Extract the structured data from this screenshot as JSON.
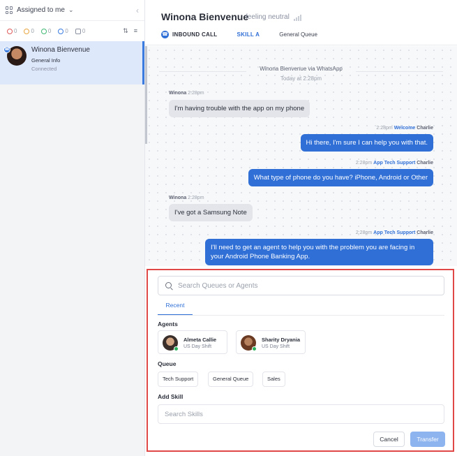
{
  "sidebar": {
    "filter_label": "Assigned to me",
    "counters": [
      {
        "icon": "alert-icon",
        "value": "0",
        "color": "#e05a5a"
      },
      {
        "icon": "clock-icon",
        "value": "0",
        "color": "#e8a640"
      },
      {
        "icon": "transfer-icon",
        "value": "0",
        "color": "#40b874"
      },
      {
        "icon": "phone-icon",
        "value": "0",
        "color": "#3a7be0"
      },
      {
        "icon": "message-icon",
        "value": "0",
        "color": "#8a90a0"
      }
    ],
    "contact": {
      "name": "Winona Bienvenue",
      "subtitle": "General Info",
      "status": "Connected"
    }
  },
  "header": {
    "name": "Winona Bienvenue",
    "sentiment": "feeling neutral",
    "call_type": "INBOUND CALL",
    "skill": "SKILL A",
    "queue": "General Queue"
  },
  "chat": {
    "source_line": "Winona Bienvenue via WhatsApp",
    "date_line": "Today at 2:28pm",
    "messages": [
      {
        "direction": "in",
        "sender": "Winona",
        "time": "2:28pm",
        "skill": "",
        "agent": "",
        "text": "I'm having trouble with the app on my phone"
      },
      {
        "direction": "out",
        "sender": "",
        "time": "2:28pm",
        "skill": "Welcome",
        "agent": "Charlie",
        "text": "Hi there, I'm sure I can help you with that."
      },
      {
        "direction": "out",
        "sender": "",
        "time": "2:28pm",
        "skill": "App Tech Support",
        "agent": "Charlie",
        "text": "What type of phone do you have? iPhone, Android or Other"
      },
      {
        "direction": "in",
        "sender": "Winona",
        "time": "2:28pm",
        "skill": "",
        "agent": "",
        "text": "I've got a Samsung Note"
      },
      {
        "direction": "out",
        "sender": "",
        "time": "2:28pm",
        "skill": "App Tech Support",
        "agent": "Charlie",
        "text": "I'll need to get an agent to help you with the problem you are facing in your Android Phone Banking App."
      }
    ]
  },
  "transfer": {
    "search_placeholder": "Search Queues or Agents",
    "tab": "Recent",
    "agents_label": "Agents",
    "agents": [
      {
        "name": "Almeta Callie",
        "shift": "US Day Shift",
        "status_color": "#29b05a"
      },
      {
        "name": "Sharity Dryania",
        "shift": "US Day Shift",
        "status_color": "#29b05a"
      }
    ],
    "queue_label": "Queue",
    "queues": [
      "Tech Support",
      "General Queue",
      "Sales"
    ],
    "skill_label": "Add Skill",
    "skill_placeholder": "Search Skills",
    "cancel_label": "Cancel",
    "transfer_label": "Transfer"
  }
}
